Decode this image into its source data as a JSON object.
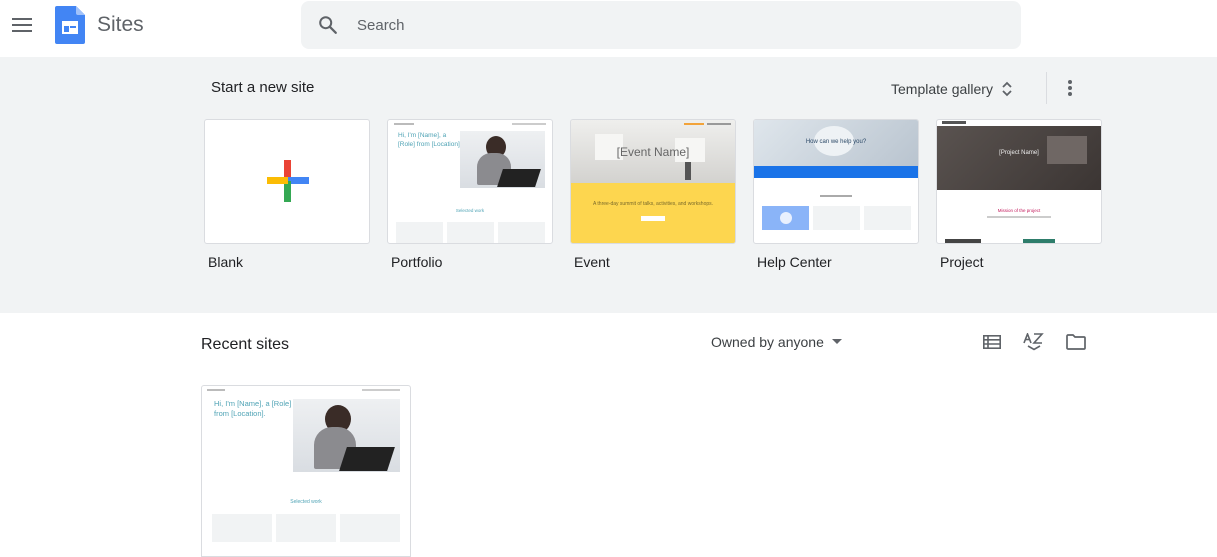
{
  "header": {
    "app_name": "Sites",
    "menu_icon": "hamburger-menu-icon",
    "search_placeholder": "Search",
    "search_icon": "magnifier-icon",
    "brand_color": "#4285f4"
  },
  "start_section": {
    "title": "Start a new site",
    "gallery_label": "Template gallery",
    "gallery_icon": "unfold-icon",
    "more_icon": "more-vert-icon",
    "templates": [
      {
        "label": "Blank"
      },
      {
        "label": "Portfolio"
      },
      {
        "label": "Event"
      },
      {
        "label": "Help Center"
      },
      {
        "label": "Project"
      }
    ]
  },
  "recent_section": {
    "title": "Recent sites",
    "owner_filter": "Owned by anyone",
    "tools": [
      "list-view-icon",
      "sort-az-icon",
      "folder-icon"
    ]
  },
  "thumbs": {
    "portfolio_heading": "Hi, I'm [Name], a [Role] from [Location].",
    "portfolio_section": "Selected work",
    "event_heading": "[Event Name]",
    "event_sub": "A three-day summit of talks, activities, and workshops.",
    "help_heading": "How can we help you?",
    "project_heading": "[Project Name]",
    "project_section": "Mission of the project",
    "recent_heading": "Hi, I'm [Name], a [Role] from [Location].",
    "recent_section": "Selected work"
  }
}
